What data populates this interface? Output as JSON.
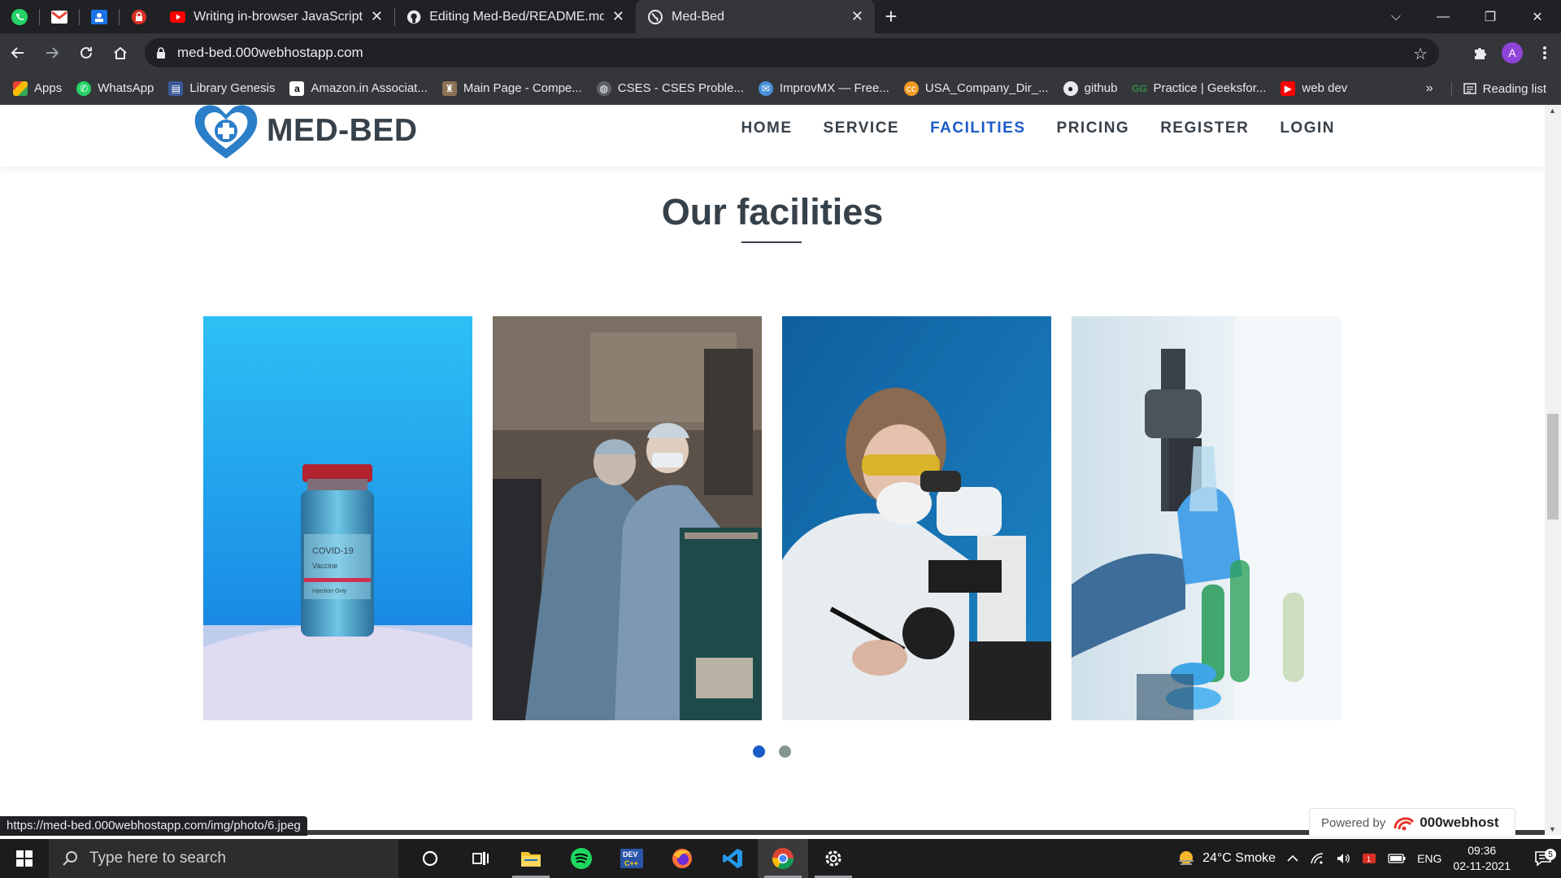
{
  "browser": {
    "tabs": [
      {
        "title": "Writing in-browser JavaScript and",
        "icon": "youtube-icon"
      },
      {
        "title": "Editing Med-Bed/README.md at",
        "icon": "github-icon"
      },
      {
        "title": "Med-Bed",
        "icon": "globe-icon"
      }
    ],
    "url": "med-bed.000webhostapp.com",
    "profile_initial": "A",
    "bookmarks": [
      {
        "label": "Apps"
      },
      {
        "label": "WhatsApp"
      },
      {
        "label": "Library Genesis"
      },
      {
        "label": "Amazon.in Associat..."
      },
      {
        "label": "Main Page - Compe..."
      },
      {
        "label": "CSES - CSES Proble..."
      },
      {
        "label": "ImprovMX — Free..."
      },
      {
        "label": "USA_Company_Dir_..."
      },
      {
        "label": "github"
      },
      {
        "label": "Practice | Geeksfor..."
      },
      {
        "label": "web dev"
      }
    ],
    "more_bookmarks": "»",
    "reading_list": "Reading list",
    "status_url": "https://med-bed.000webhostapp.com/img/photo/6.jpeg"
  },
  "site": {
    "logo_text": "MED-BED",
    "nav": [
      {
        "label": "HOME",
        "active": false
      },
      {
        "label": "SERVICE",
        "active": false
      },
      {
        "label": "FACILITIES",
        "active": true
      },
      {
        "label": "PRICING",
        "active": false
      },
      {
        "label": "REGISTER",
        "active": false
      },
      {
        "label": "LOGIN",
        "active": false
      }
    ],
    "section_title": "Our facilities",
    "vial_text": [
      "COVID-19",
      "Vaccine",
      "Injection Only"
    ],
    "carousel": {
      "pages": 2,
      "active_page": 1
    },
    "powered_by": "Powered by",
    "host_brand": "000webhost"
  },
  "colors": {
    "accent": "#1a5cc8",
    "text": "#37414a",
    "dot_inactive": "#869791"
  },
  "taskbar": {
    "search_placeholder": "Type here to search",
    "weather": "24°C  Smoke",
    "language": "ENG",
    "time": "09:36",
    "date": "02-11-2021",
    "notifications": "5"
  }
}
